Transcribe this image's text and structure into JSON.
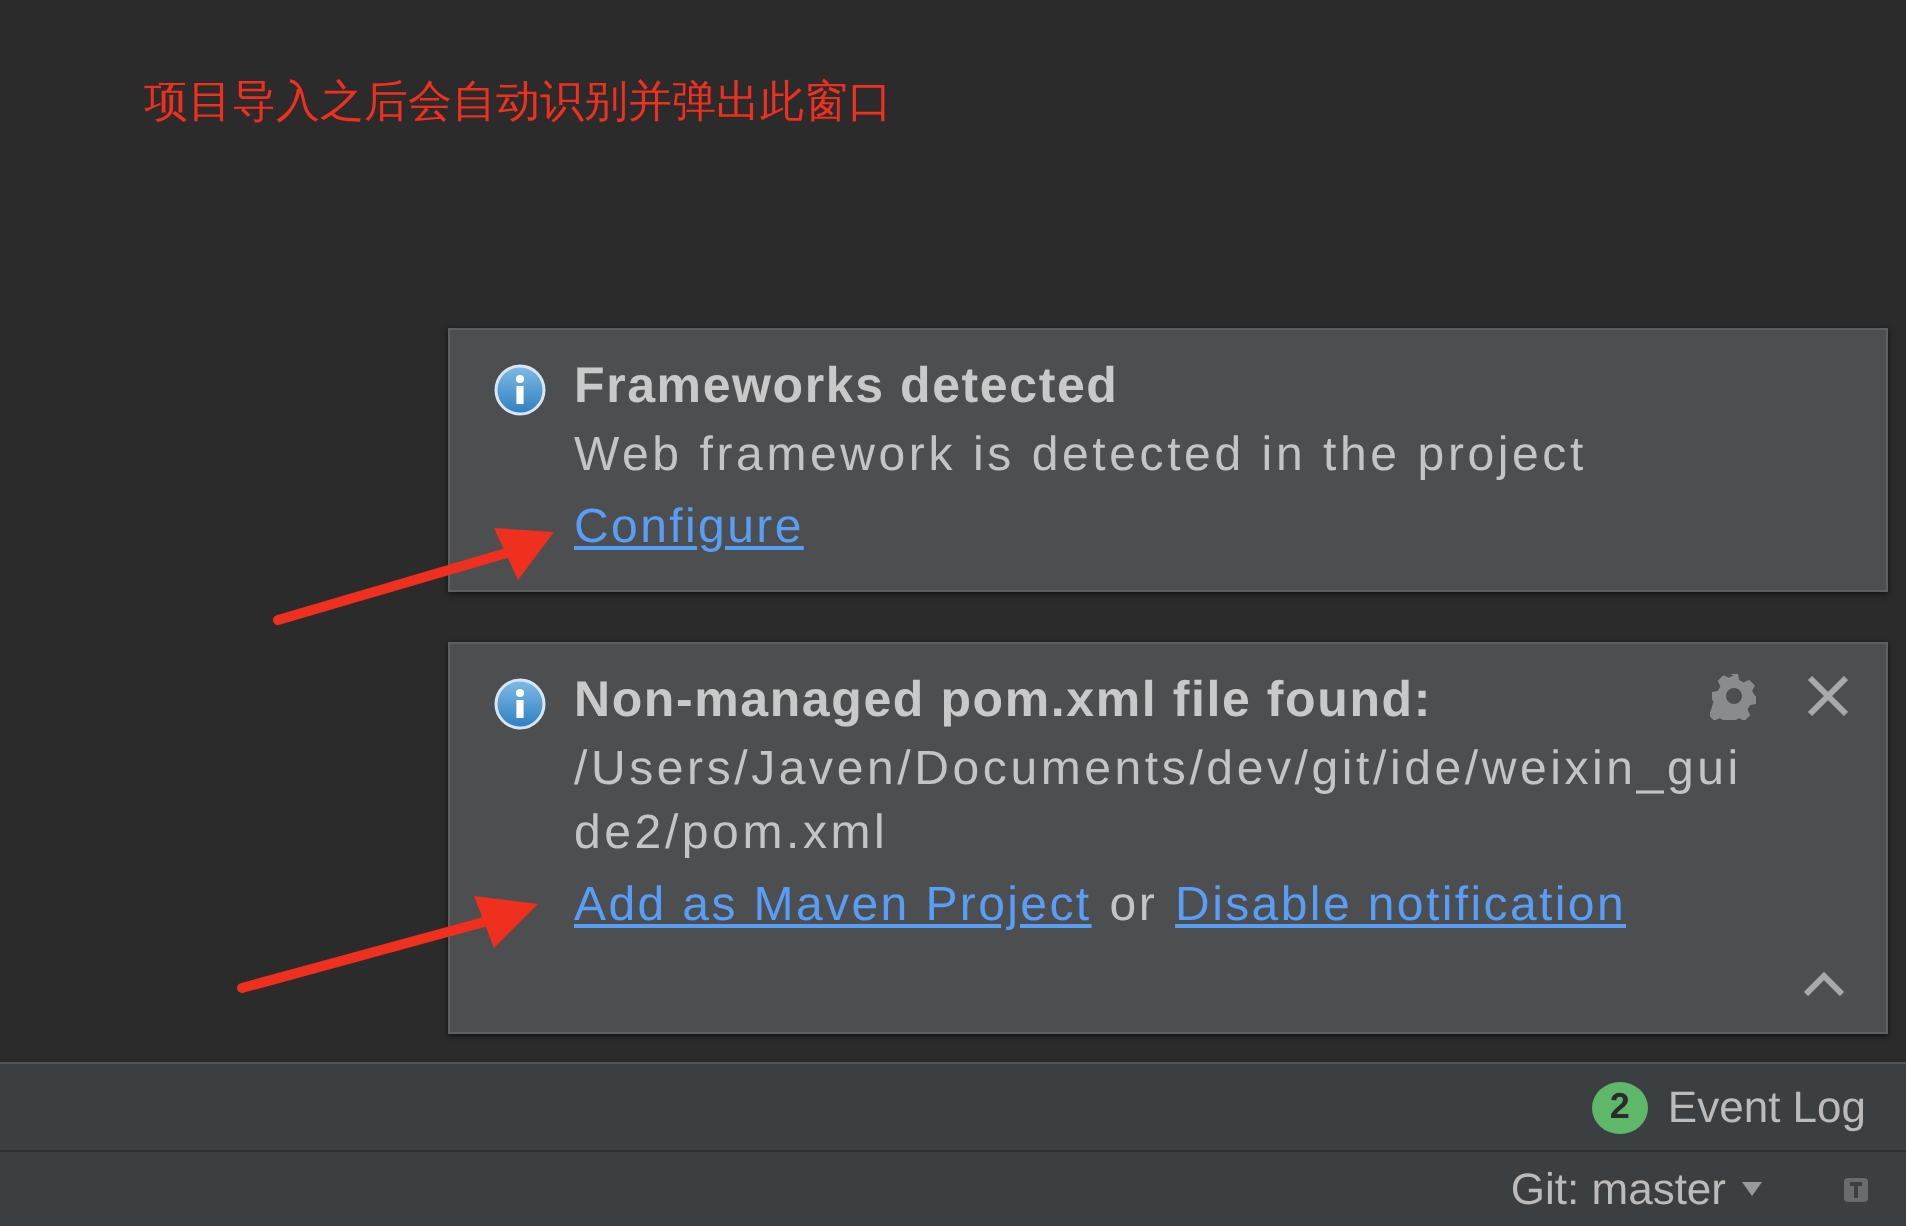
{
  "annotation": "项目导入之后会自动识别并弹出此窗口",
  "notifications": [
    {
      "title": "Frameworks detected",
      "body": "Web framework is detected in the project",
      "controls": false,
      "actions": [
        {
          "kind": "link",
          "text": "Configure"
        }
      ]
    },
    {
      "title": "Non-managed pom.xml file found:",
      "body": "/Users/Javen/Documents/dev/git/ide/weixin_guide2/pom.xml",
      "controls": true,
      "actions": [
        {
          "kind": "link",
          "text": "Add as Maven Project"
        },
        {
          "kind": "text",
          "text": "or"
        },
        {
          "kind": "link",
          "text": "Disable notification"
        }
      ]
    }
  ],
  "event_log": {
    "count": "2",
    "label": "Event Log"
  },
  "status_bar": {
    "branch": "Git: master"
  }
}
